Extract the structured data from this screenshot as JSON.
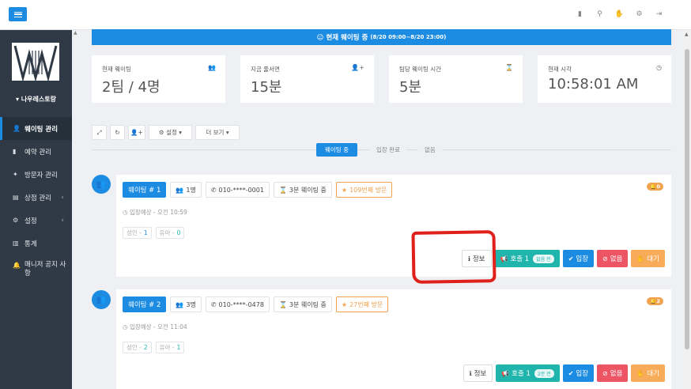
{
  "sidebar": {
    "store_name": "나우레스토랑",
    "items": [
      {
        "label": "웨이팅 관리",
        "icon": "person-icon",
        "active": true
      },
      {
        "label": "예약 관리",
        "icon": "bookmark-icon"
      },
      {
        "label": "방문자 관리",
        "icon": "visitor-icon"
      },
      {
        "label": "상점 관리",
        "icon": "store-icon",
        "arrow": "‹"
      },
      {
        "label": "설정",
        "icon": "gear-icon",
        "arrow": "‹"
      },
      {
        "label": "통계",
        "icon": "chart-icon"
      },
      {
        "label": "매니저 공지 사항",
        "icon": "bell-icon"
      }
    ]
  },
  "banner": {
    "text": "☺ 현재 웨이팅 중",
    "range": "(8/20 09:00~8/20 23:00)"
  },
  "stats": [
    {
      "label": "현재 웨이팅",
      "value": "2팀 / 4명",
      "icon": "users-icon"
    },
    {
      "label": "지금 줄서면",
      "value": "15분",
      "icon": "user-plus-icon"
    },
    {
      "label": "팀당 웨이팅 시간",
      "value": "5분",
      "icon": "hourglass-icon"
    },
    {
      "label": "현재 시각",
      "value": "10:58:01 AM",
      "icon": "clock-icon"
    }
  ],
  "toolbar": {
    "settings_label": "설정",
    "more_label": "더 보기"
  },
  "tabs": [
    "웨이팅 중",
    "입장 완료",
    "없음"
  ],
  "cards": [
    {
      "number_label": "웨이팅 # 1",
      "people": "1명",
      "phone": "010-****-0001",
      "waiting": "3분 웨이팅 중",
      "visit": "109번째 방문",
      "count": "0",
      "eta": "입장예상 - 오전 10:59",
      "adult_label": "성인 -",
      "adult": "1",
      "child_label": "유아 -",
      "child": "0",
      "call_time": "없음 전"
    },
    {
      "number_label": "웨이팅 # 2",
      "people": "3명",
      "phone": "010-****-0478",
      "waiting": "3분 웨이팅 중",
      "visit": "27번째 방문",
      "count": "2",
      "eta": "입장예상 - 오전 11:04",
      "adult_label": "성인 -",
      "adult": "2",
      "child_label": "유아 -",
      "child": "1",
      "call_time": "2분 전"
    }
  ],
  "actions": {
    "info": "정보",
    "call": "호출 1",
    "enter": "입장",
    "none": "없음",
    "wait": "대기"
  },
  "colors": {
    "primary": "#1c8ce3",
    "teal": "#1fb5ac",
    "danger": "#ed5565",
    "warning": "#f8ac59",
    "sidebar": "#2f3a46",
    "annotation": "#e0201a"
  }
}
